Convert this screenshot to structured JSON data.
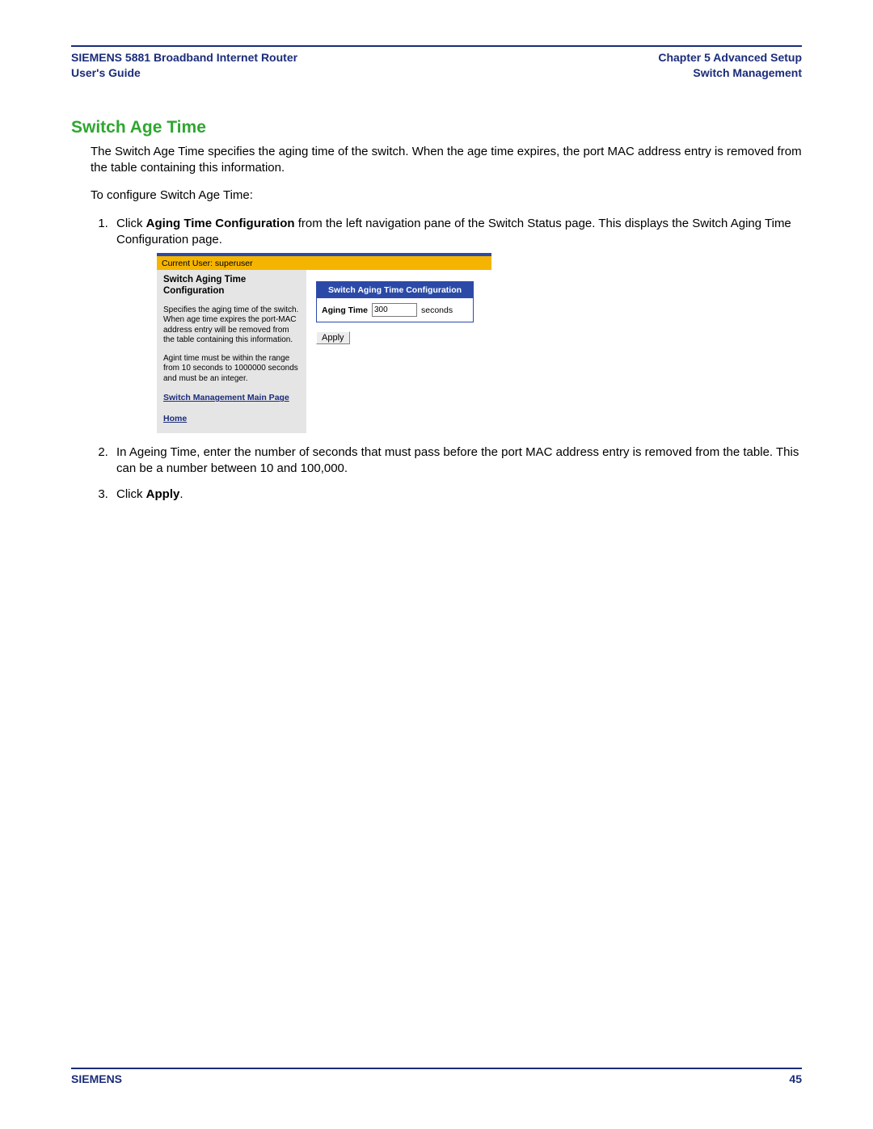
{
  "header": {
    "product_line1": "SIEMENS 5881 Broadband Internet Router",
    "product_line2": "User's Guide",
    "chapter_line1": "Chapter 5  Advanced Setup",
    "chapter_line2": "Switch Management"
  },
  "section": {
    "title": "Switch Age Time",
    "intro": "The Switch Age Time specifies the aging time of the switch. When the age time expires, the port MAC address entry is removed from the table containing this information.",
    "to_configure": "To configure Switch Age Time:"
  },
  "steps": {
    "s1_prefix": "Click ",
    "s1_bold": "Aging Time Configuration",
    "s1_suffix": " from the left navigation pane of the Switch Status page. This displays the Switch Aging Time Configuration page.",
    "s2": "In Ageing Time, enter the number of seconds that must pass before the port MAC address entry is removed from the table. This can be a number between 10 and 100,000.",
    "s3_prefix": "Click ",
    "s3_bold": "Apply",
    "s3_suffix": "."
  },
  "embed": {
    "gold_bar": "Current User: superuser",
    "left_title": "Switch Aging Time Configuration",
    "left_p1": "Specifies the aging time of the switch. When age time expires the port-MAC address entry will be removed from the table containing this information.",
    "left_p2": "Agint time must be within the range from 10 seconds to 1000000 seconds and must be an integer.",
    "link_main": "Switch Management Main Page",
    "link_home": "Home",
    "panel_title": "Switch Aging Time Configuration",
    "field_label": "Aging Time",
    "field_value": "300",
    "field_unit": "seconds",
    "apply_label": "Apply"
  },
  "footer": {
    "brand": "SIEMENS",
    "page_no": "45"
  }
}
